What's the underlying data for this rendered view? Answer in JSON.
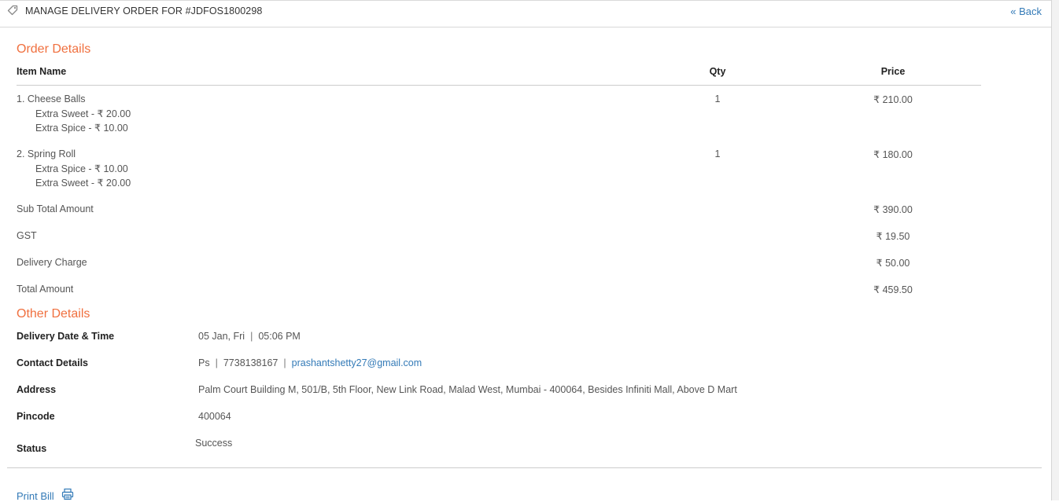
{
  "header": {
    "title": "MANAGE DELIVERY ORDER FOR #JDFOS1800298",
    "back_label": "« Back",
    "icon": "tag-icon"
  },
  "order_details": {
    "title": "Order Details",
    "columns": {
      "item": "Item Name",
      "qty": "Qty",
      "price": "Price"
    },
    "items": [
      {
        "name": "1. Cheese Balls",
        "qty": "1",
        "price": "₹ 210.00",
        "addons": [
          "Extra Sweet - ₹ 20.00",
          "Extra Spice - ₹ 10.00"
        ]
      },
      {
        "name": "2. Spring Roll",
        "qty": "1",
        "price": "₹ 180.00",
        "addons": [
          "Extra Spice - ₹ 10.00",
          "Extra Sweet - ₹ 20.00"
        ]
      }
    ],
    "summary": [
      {
        "label": "Sub Total Amount",
        "value": "₹ 390.00"
      },
      {
        "label": "GST",
        "value": "₹ 19.50"
      },
      {
        "label": "Delivery Charge",
        "value": "₹ 50.00"
      },
      {
        "label": "Total Amount",
        "value": "₹ 459.50"
      }
    ]
  },
  "other_details": {
    "title": "Other Details",
    "delivery": {
      "label": "Delivery Date & Time",
      "date": "05 Jan, Fri",
      "time": "05:06 PM"
    },
    "contact": {
      "label": "Contact Details",
      "name": "Ps",
      "phone": "7738138167",
      "email": "prashantshetty27@gmail.com"
    },
    "address": {
      "label": "Address",
      "value": "Palm Court Building M, 501/B, 5th Floor, New Link Road, Malad West, Mumbai - 400064, Besides Infiniti Mall, Above D Mart"
    },
    "pincode": {
      "label": "Pincode",
      "value": "400064"
    },
    "status": {
      "label": "Status",
      "value": "Success"
    }
  },
  "footer": {
    "print_label": "Print Bill",
    "print_icon": "printer-icon"
  },
  "colors": {
    "accent": "#f0703f",
    "link": "#337ab7",
    "text": "#555555",
    "heading": "#222222"
  }
}
